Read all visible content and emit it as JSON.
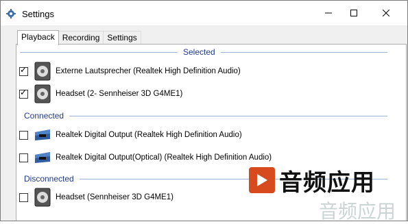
{
  "window": {
    "title": "Settings"
  },
  "tabs": [
    {
      "label": "Playback"
    },
    {
      "label": "Recording"
    },
    {
      "label": "Settings"
    }
  ],
  "groups": {
    "selected": "Selected",
    "connected": "Connected",
    "disconnected": "Disconnected"
  },
  "devices": [
    {
      "label": "Externe Lautsprecher (Realtek High Definition Audio)",
      "checked": true,
      "icon": "speaker-icon"
    },
    {
      "label": "Headset (2- Sennheiser 3D G4ME1)",
      "checked": true,
      "icon": "speaker-icon"
    },
    {
      "label": "Realtek Digital Output (Realtek High Definition Audio)",
      "checked": false,
      "icon": "digital-output-icon"
    },
    {
      "label": "Realtek Digital Output(Optical) (Realtek High Definition Audio)",
      "checked": false,
      "icon": "digital-output-icon"
    },
    {
      "label": "Headset (Sennheiser 3D G4ME1)",
      "checked": false,
      "icon": "speaker-icon"
    }
  ],
  "checkmark": "✓",
  "watermark": {
    "text": "音频应用",
    "text2": "音频应用"
  },
  "colors": {
    "group_header": "#1e3a8a",
    "watermark_badge": "#d64a1e"
  }
}
